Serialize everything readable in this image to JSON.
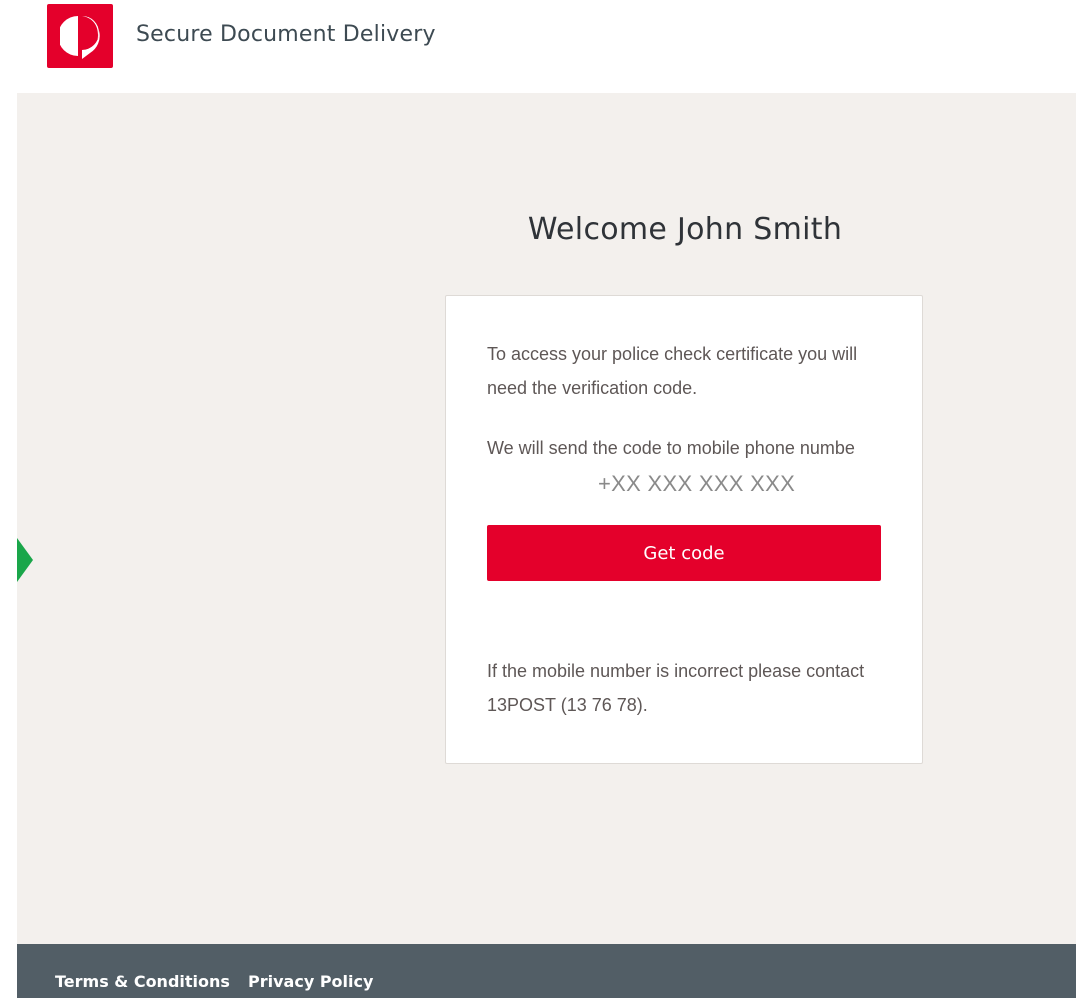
{
  "header": {
    "logo_icon": "australia-post-logo-icon",
    "brand_color": "#e4002b",
    "title": "Secure Document Delivery"
  },
  "main": {
    "welcome": "Welcome John Smith",
    "arrow_icon": "green-arrow-right-icon",
    "card": {
      "intro": "To access your police check certificate you will need the verification code.",
      "send_prefix": "We will send the code to mobile phone numbe",
      "phone_number": "+XX XXX XXX XXX",
      "button_label": "Get code",
      "contact_note": "If the mobile number is incorrect please contact 13POST (13 76 78)."
    }
  },
  "footer": {
    "links": [
      "Terms & Conditions",
      "Privacy Policy"
    ]
  }
}
